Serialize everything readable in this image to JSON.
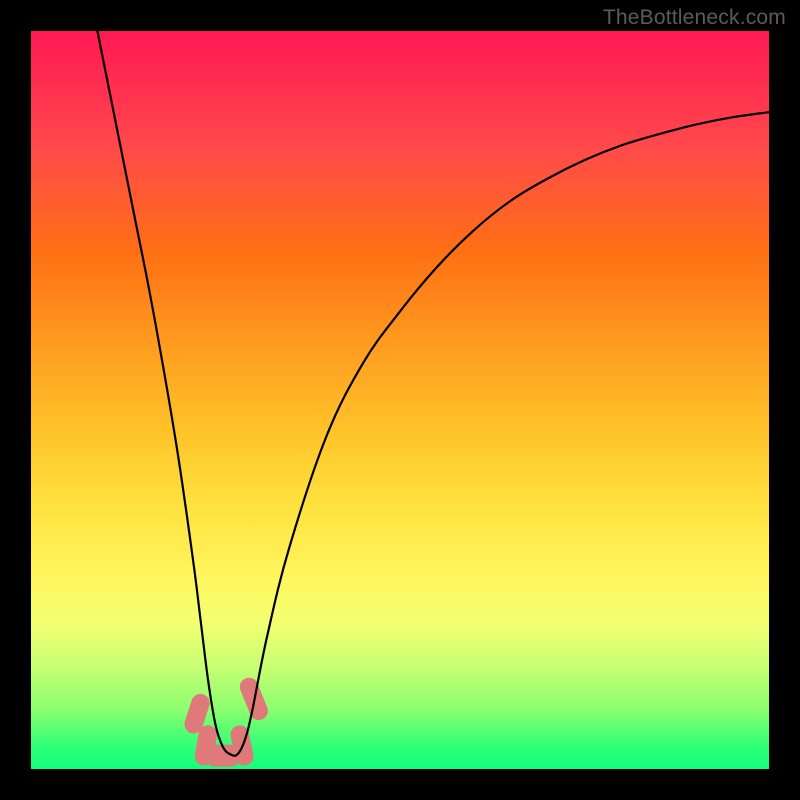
{
  "watermark": "TheBottleneck.com",
  "chart_data": {
    "type": "line",
    "title": "",
    "xlabel": "",
    "ylabel": "",
    "xlim": [
      0,
      100
    ],
    "ylim": [
      0,
      100
    ],
    "grid": false,
    "legend": false,
    "background": "heatmap-gradient-red-to-green-vertical",
    "series": [
      {
        "name": "bottleneck-curve",
        "color": "#000000",
        "x": [
          9,
          10,
          12,
          14,
          16,
          18,
          20,
          22,
          23,
          24,
          25,
          26,
          27,
          28,
          29,
          30,
          32,
          35,
          40,
          45,
          50,
          55,
          60,
          65,
          70,
          75,
          80,
          85,
          90,
          95,
          100
        ],
        "y": [
          100,
          95,
          85,
          75,
          65,
          54,
          42,
          28,
          20,
          12,
          6,
          3,
          2,
          2,
          4,
          8,
          18,
          30,
          45,
          55,
          62,
          68,
          73,
          77,
          80,
          82.5,
          84.5,
          86,
          87.3,
          88.3,
          89
        ]
      }
    ],
    "markers": [
      {
        "name": "left-marker-1",
        "x": 22.5,
        "y": 7.5,
        "color": "#e07a7a",
        "shape": "rounded-rect",
        "w": 2.5,
        "h": 5.5,
        "angle_deg": 18
      },
      {
        "name": "left-marker-2",
        "x": 23.7,
        "y": 3.2,
        "color": "#e07a7a",
        "shape": "rounded-rect",
        "w": 2.5,
        "h": 5.5,
        "angle_deg": 10
      },
      {
        "name": "right-marker-1",
        "x": 28.6,
        "y": 3.2,
        "color": "#e07a7a",
        "shape": "rounded-rect",
        "w": 2.5,
        "h": 5.5,
        "angle_deg": -12
      },
      {
        "name": "right-marker-2",
        "x": 30.2,
        "y": 9.5,
        "color": "#e07a7a",
        "shape": "rounded-rect",
        "w": 2.5,
        "h": 6.0,
        "angle_deg": -22
      },
      {
        "name": "base-marker",
        "x": 26.0,
        "y": 1.8,
        "color": "#e07a7a",
        "shape": "rounded-rect",
        "w": 5.0,
        "h": 3.0,
        "angle_deg": 0
      }
    ]
  }
}
